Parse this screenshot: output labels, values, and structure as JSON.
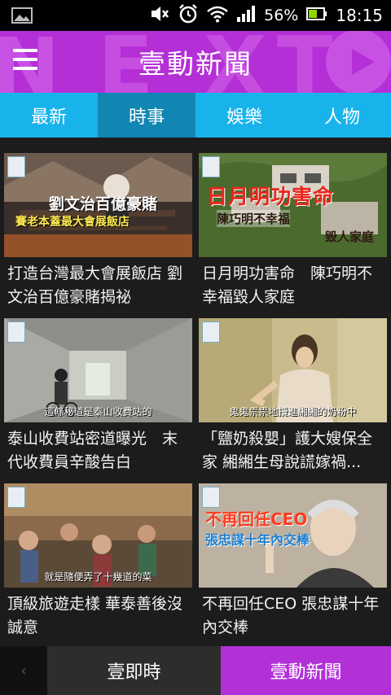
{
  "status_bar": {
    "battery": "56%",
    "time": "18:15",
    "icons": [
      "image-icon",
      "mute-icon",
      "alarm-icon",
      "wifi-icon",
      "signal-icon",
      "battery-icon"
    ]
  },
  "header": {
    "title": "壹動新聞",
    "menu_icon": "hamburger-menu-icon",
    "accent_color": "#b42fd6"
  },
  "tabs": [
    {
      "label": "最新",
      "active": false
    },
    {
      "label": "時事",
      "active": true
    },
    {
      "label": "娛樂",
      "active": false
    },
    {
      "label": "人物",
      "active": false
    }
  ],
  "articles": [
    {
      "caption": "打造台灣最大會展飯店 劉文治百億豪賭揭祕",
      "thumb_text_1": "劉文治百億豪賭",
      "thumb_text_2": "賽老本蓋最大會展飯店"
    },
    {
      "caption": "日月明功害命　陳巧明不幸福毀人家庭",
      "thumb_text_1": "日月明功害命",
      "thumb_text_2": "陳巧明不幸福",
      "thumb_text_3": "毀人家庭"
    },
    {
      "caption": "泰山收費站密道曝光　末代收費員辛酸告白",
      "thumb_text_1": "這條秘道是泰山收費站的"
    },
    {
      "caption": "「鹽奶殺嬰」護大嫂保全家 緗緗生母說謊嫁禍...",
      "thumb_text_1": "鬼鬼祟祟地攪進緗緗的奶粉中"
    },
    {
      "caption": "頂級旅遊走樣 華泰善後沒誠意",
      "thumb_text_1": "就是隨便弄了十幾道的菜"
    },
    {
      "caption": "不再回任CEO 張忠謀十年內交棒",
      "thumb_text_1": "不再回任CEO",
      "thumb_text_2": "張忠謀十年內交棒"
    }
  ],
  "bottom_bar": {
    "back_icon": "chevron-left-icon",
    "left_label": "壹即時",
    "right_label": "壹動新聞",
    "right_color": "#b231d7"
  }
}
